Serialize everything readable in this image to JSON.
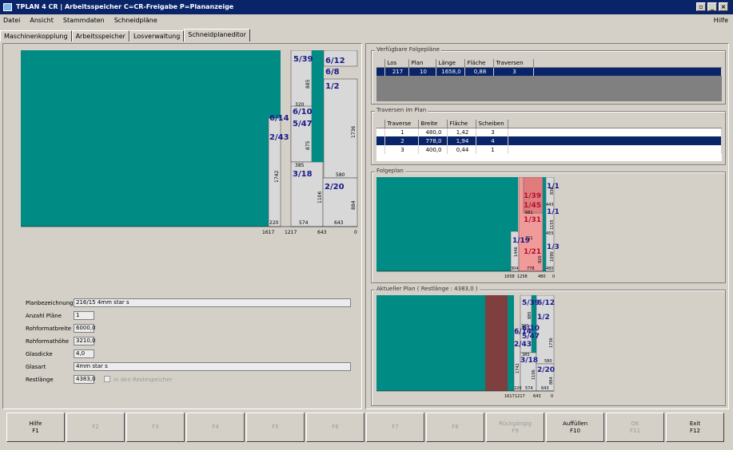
{
  "window": {
    "title": "TPLAN 4 CR | Arbeitsspeicher C=CR-Freigabe P=Plananzeige"
  },
  "menu": {
    "items": [
      "Datei",
      "Ansicht",
      "Stammdaten",
      "Schneidpläne"
    ],
    "help": "Hilfe"
  },
  "tabs": [
    "Maschinenkopplung",
    "Arbeitsspeicher",
    "Losverwaltung",
    "Schneidplaneditor"
  ],
  "main_plan": {
    "pieces": [
      "5/39",
      "6/12",
      "6/8",
      "1/2",
      "6/14",
      "6/10",
      "5/47",
      "2/43",
      "3/18",
      "2/20"
    ],
    "dims": [
      "885",
      "320",
      "1736",
      "875",
      "385",
      "580",
      "1106",
      "884",
      "1742",
      "220",
      "574",
      "643"
    ],
    "bottom": [
      "1617",
      "1217",
      "643",
      "0"
    ]
  },
  "form": {
    "planbezeichnung": {
      "label": "Planbezeichnung",
      "value": "216/15 4mm star s"
    },
    "anzahl": {
      "label": "Anzahl Pläne",
      "value": "1"
    },
    "breite": {
      "label": "Rohformatbreite",
      "value": "6000,0"
    },
    "hoehe": {
      "label": "Rohformathöhe",
      "value": "3210,0"
    },
    "dicke": {
      "label": "Glasdicke",
      "value": "4,0"
    },
    "glasart": {
      "label": "Glasart",
      "value": "4mm star s"
    },
    "restlaenge": {
      "label": "Restlänge",
      "value": "4383,0",
      "check": "in den Restespeicher"
    }
  },
  "folgeplaene": {
    "title": "Verfügbare Folgepläne",
    "columns": [
      "Los",
      "Plan",
      "Länge",
      "Fläche",
      "Traversen"
    ],
    "rows": [
      [
        "217",
        "10",
        "1658,0",
        "0,88",
        "3"
      ]
    ]
  },
  "traversen": {
    "title": "Traversen im Plan",
    "columns": [
      "Traverse",
      "Breite",
      "Fläche",
      "Scheiben"
    ],
    "rows": [
      [
        "1",
        "480,0",
        "1,42",
        "3"
      ],
      [
        "2",
        "778,0",
        "1,94",
        "4"
      ],
      [
        "3",
        "400,0",
        "0,44",
        "1"
      ]
    ]
  },
  "folgeplan": {
    "title": "Folgeplan",
    "pieces": [
      "1/1",
      "1/39",
      "1/45",
      "1/1",
      "1/31",
      "1/19",
      "1/3",
      "1/21"
    ],
    "dims": [
      "836",
      "443",
      "1155",
      "455",
      "721",
      "1090",
      "920",
      "1446",
      "304",
      "778",
      "480",
      "681"
    ],
    "bottom": [
      "1658",
      "1258",
      "480",
      "0"
    ]
  },
  "aktueller": {
    "title": "Aktueller Plan ( Restlänge : 4383,0 )",
    "pieces": [
      "5/39",
      "6/12",
      "1/2",
      "6/14",
      "6/10",
      "5/47",
      "2/43",
      "3/18",
      "2/20"
    ],
    "dims": [
      "885",
      "320",
      "1736",
      "385",
      "580",
      "1106",
      "884",
      "1742",
      "220",
      "574",
      "643"
    ],
    "bottom": [
      "1617",
      "1217",
      "643",
      "0"
    ]
  },
  "fkeys": [
    {
      "l1": "Hilfe",
      "l2": "F1",
      "on": true
    },
    {
      "l1": "",
      "l2": "F2",
      "on": false
    },
    {
      "l1": "",
      "l2": "F3",
      "on": false
    },
    {
      "l1": "",
      "l2": "F4",
      "on": false
    },
    {
      "l1": "",
      "l2": "F5",
      "on": false
    },
    {
      "l1": "",
      "l2": "F6",
      "on": false
    },
    {
      "l1": "",
      "l2": "F7",
      "on": false
    },
    {
      "l1": "",
      "l2": "F8",
      "on": false
    },
    {
      "l1": "Rückgängig",
      "l2": "F9",
      "on": false
    },
    {
      "l1": "Auffüllen",
      "l2": "F10",
      "on": true
    },
    {
      "l1": "OK",
      "l2": "F11",
      "on": false
    },
    {
      "l1": "Exit",
      "l2": "F12",
      "on": true
    }
  ],
  "colors": {
    "teal": "#008b84",
    "pane": "#d8d8d8",
    "red": "#f09a9a",
    "brown": "#7e3f3e",
    "navy": "#0a246a",
    "label": "#1a1a8c",
    "redlabel": "#b01030"
  }
}
